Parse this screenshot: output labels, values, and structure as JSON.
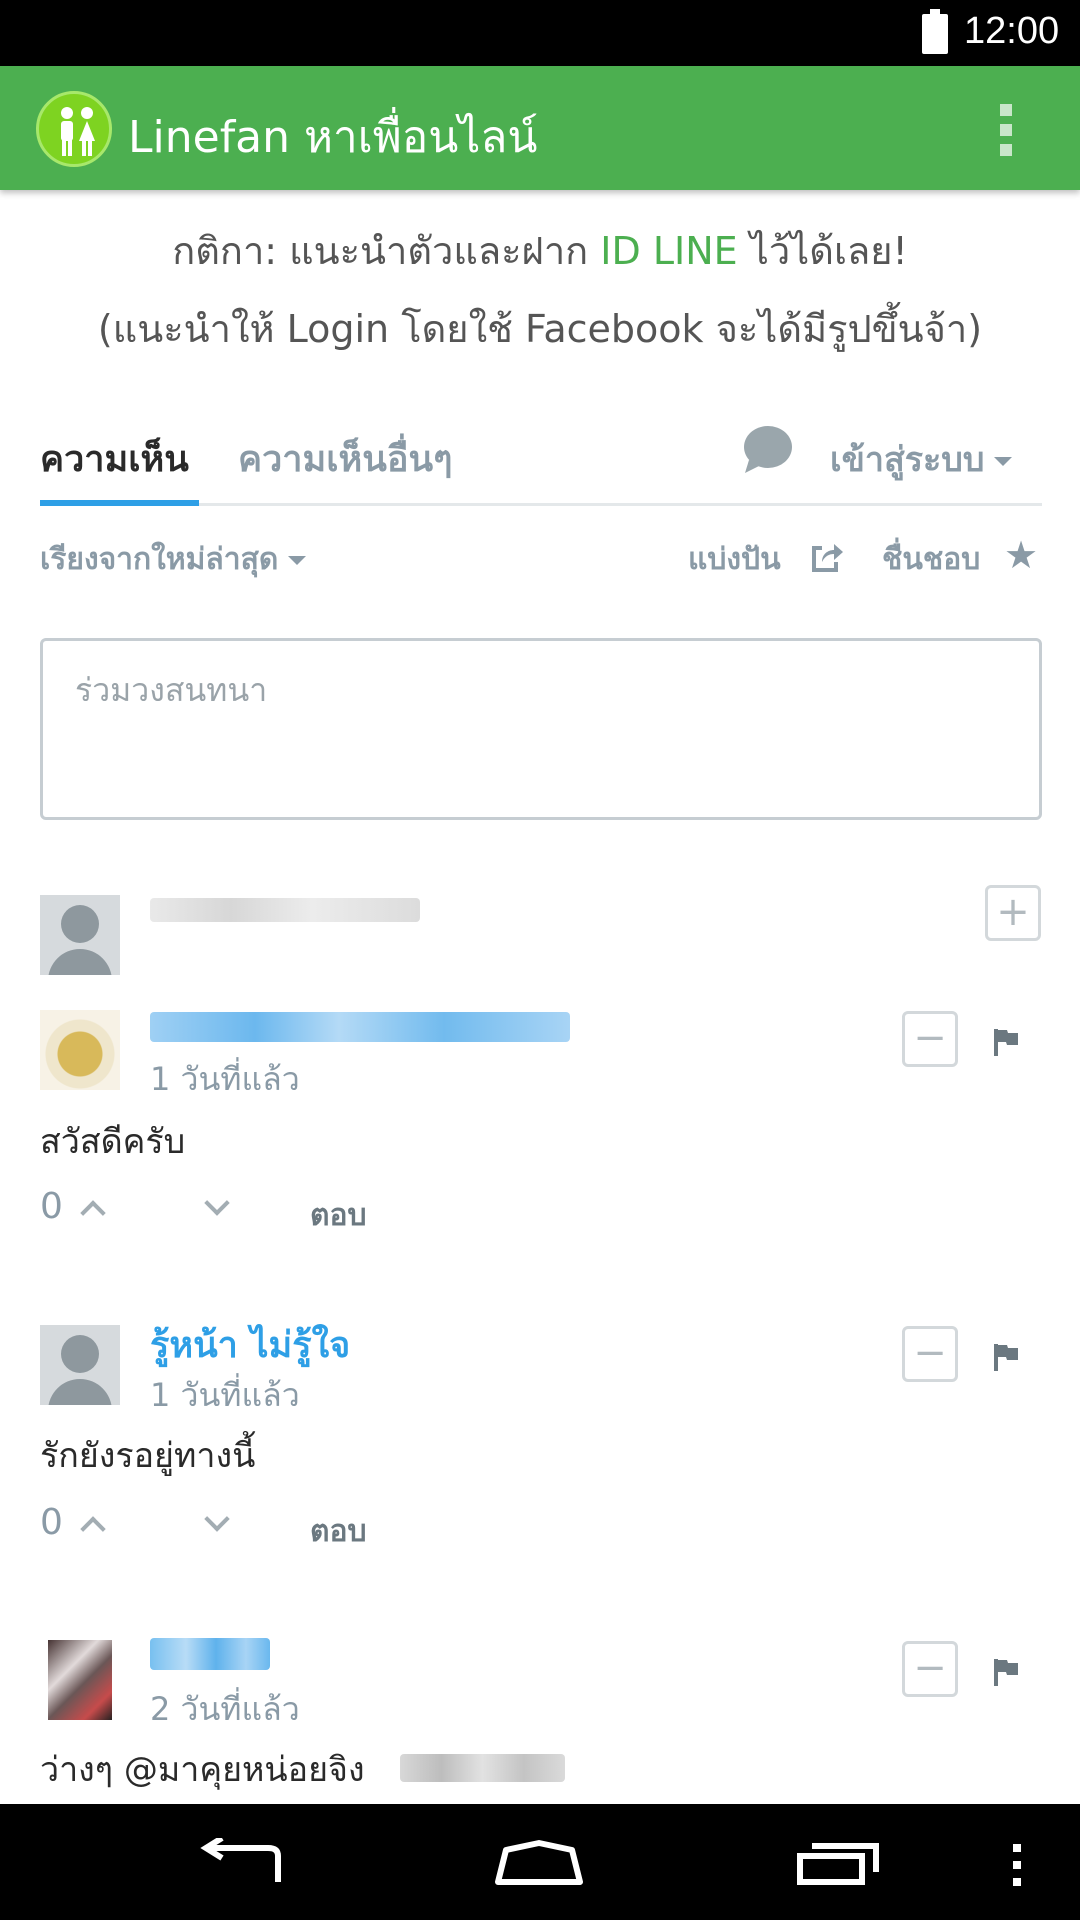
{
  "status_bar": {
    "time": "12:00",
    "battery_icon": "battery-full-icon"
  },
  "app_bar": {
    "title": "Linefan หาเพื่อนไลน์",
    "logo_icon": "couple-icon",
    "menu_icon": "overflow-menu-icon",
    "brand_color": "#4caf50"
  },
  "rules": {
    "prefix": "กติกา: แนะนำตัวและฝาก ",
    "highlight": "ID LINE",
    "suffix": " ไว้ได้เลย!",
    "note": "(แนะนำให้ Login โดยใช้ Facebook จะได้มีรูปขึ้นจ้า)"
  },
  "tabs": {
    "active": "ความเห็น",
    "other": "ความเห็นอื่นๆ",
    "login": "เข้าสู่ระบบ"
  },
  "toolbar": {
    "sort": "เรียงจากใหม่ล่าสุด",
    "share": "แบ่งปัน",
    "favorite": "ชื่นชอบ"
  },
  "compose": {
    "placeholder": "ร่วมวงสนทนา"
  },
  "comments": [
    {
      "time": "1 วันที่แล้ว",
      "body": "สวัสดีครับ",
      "votes": "0",
      "reply": "ตอบ"
    },
    {
      "name": "รู้หน้า ไม่รู้ใจ",
      "time": "1 วันที่แล้ว",
      "body": "รักยังรอยู่ทางนี้",
      "votes": "0",
      "reply": "ตอบ"
    },
    {
      "time": "2 วันที่แล้ว",
      "body": "ว่างๆ @มาคุยหน่อยจิง"
    }
  ],
  "accent_color": "#2e9fe6"
}
